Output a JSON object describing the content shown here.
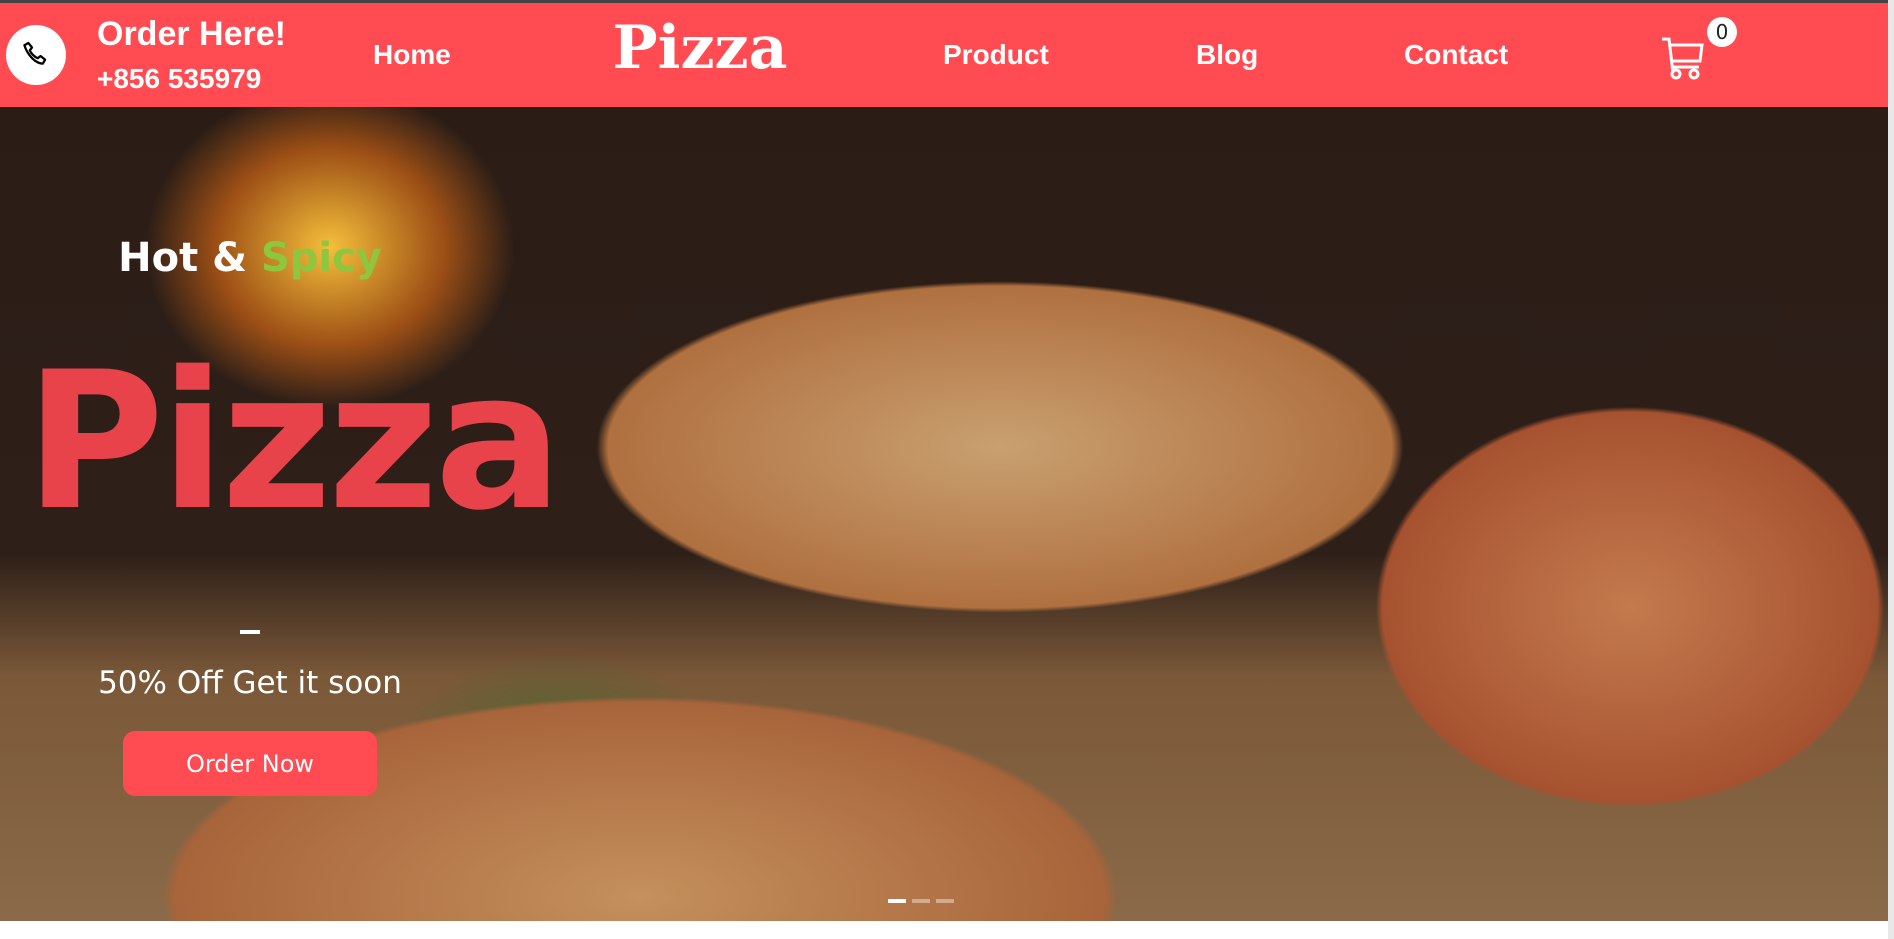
{
  "header": {
    "order_label": "Order Here!",
    "phone": "+856 535979",
    "logo": "Pizza",
    "nav": [
      "Home",
      "Product",
      "Blog",
      "Contact"
    ],
    "cart_count": "0",
    "brand_color": "#FF4B51"
  },
  "hero": {
    "tagline_a": "Hot &",
    "tagline_b": "Spicy",
    "title": "Pizza",
    "dash": "–",
    "offer": "50% Off Get it soon",
    "cta": "Order Now",
    "slides": 3,
    "active_slide": 1,
    "accent_green": "#8DC63F",
    "title_color": "#E8424B"
  }
}
